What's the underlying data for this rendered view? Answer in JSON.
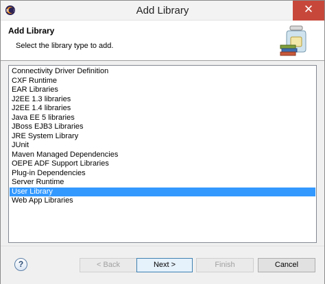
{
  "window": {
    "title": "Add Library",
    "close_glyph": "✕"
  },
  "header": {
    "title": "Add Library",
    "description": "Select the library type to add.",
    "icon": "library-jar-books-icon"
  },
  "libraries": [
    "Connectivity Driver Definition",
    "CXF Runtime",
    "EAR Libraries",
    "J2EE 1.3 libraries",
    "J2EE 1.4 libraries",
    "Java EE 5 libraries",
    "JBoss EJB3 Libraries",
    "JRE System Library",
    "JUnit",
    "Maven Managed Dependencies",
    "OEPE ADF Support Libraries",
    "Plug-in Dependencies",
    "Server Runtime",
    "User Library",
    "Web App Libraries"
  ],
  "selected_library": "User Library",
  "buttons": {
    "help": "?",
    "back": "< Back",
    "next": "Next >",
    "finish": "Finish",
    "cancel": "Cancel"
  },
  "colors": {
    "selection": "#3399ff",
    "close": "#c7483b"
  }
}
